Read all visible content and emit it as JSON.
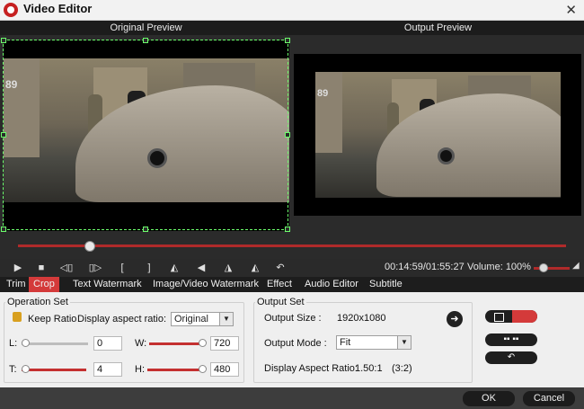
{
  "window": {
    "title": "Video Editor",
    "close": "✕"
  },
  "preview": {
    "original_label": "Original Preview",
    "output_label": "Output Preview",
    "scene_number": "89"
  },
  "playback": {
    "progress": 0.13,
    "timecode": "00:14:59/01:55:27",
    "volume_label": "Volume:",
    "volume_value": "100%",
    "volume_level": 0.25
  },
  "controls": [
    {
      "name": "play-icon",
      "glyph": "▶"
    },
    {
      "name": "stop-icon",
      "glyph": "■"
    },
    {
      "name": "prev-frame-icon",
      "glyph": "◁▯"
    },
    {
      "name": "next-frame-icon",
      "glyph": "▯▷"
    },
    {
      "name": "mark-in-icon",
      "glyph": "["
    },
    {
      "name": "mark-out-icon",
      "glyph": "]"
    },
    {
      "name": "flip-horizontal-icon",
      "glyph": "◭"
    },
    {
      "name": "flip-left-icon",
      "glyph": "◀"
    },
    {
      "name": "rotate-left-icon",
      "glyph": "◮"
    },
    {
      "name": "rotate-right-icon",
      "glyph": "◭"
    },
    {
      "name": "undo-icon",
      "glyph": "↶"
    }
  ],
  "tabs": [
    "Trim",
    "Crop",
    "Text Watermark",
    "Image/Video Watermark",
    "Effect",
    "Audio Editor",
    "Subtitle"
  ],
  "active_tab": "Crop",
  "operation_set": {
    "title": "Operation Set",
    "keep_ratio_label": "Keep Ratio",
    "display_aspect_label": "Display aspect ratio:",
    "aspect_value": "Original",
    "L_label": "L:",
    "L_value": "0",
    "W_label": "W:",
    "W_value": "720",
    "T_label": "T:",
    "T_value": "4",
    "H_label": "H:",
    "H_value": "480"
  },
  "output_set": {
    "title": "Output Set",
    "size_label": "Output Size :",
    "size_value": "1920x1080",
    "mode_label": "Output Mode :",
    "mode_value": "Fit",
    "dar_label": "Display Aspect Ratio:",
    "dar_value": "1.50:1",
    "dar_ratio": "(3:2)"
  },
  "buttons": {
    "ok": "OK",
    "cancel": "Cancel"
  },
  "colors": {
    "accent": "#d43a3a",
    "crop_border": "#6cff6c"
  }
}
